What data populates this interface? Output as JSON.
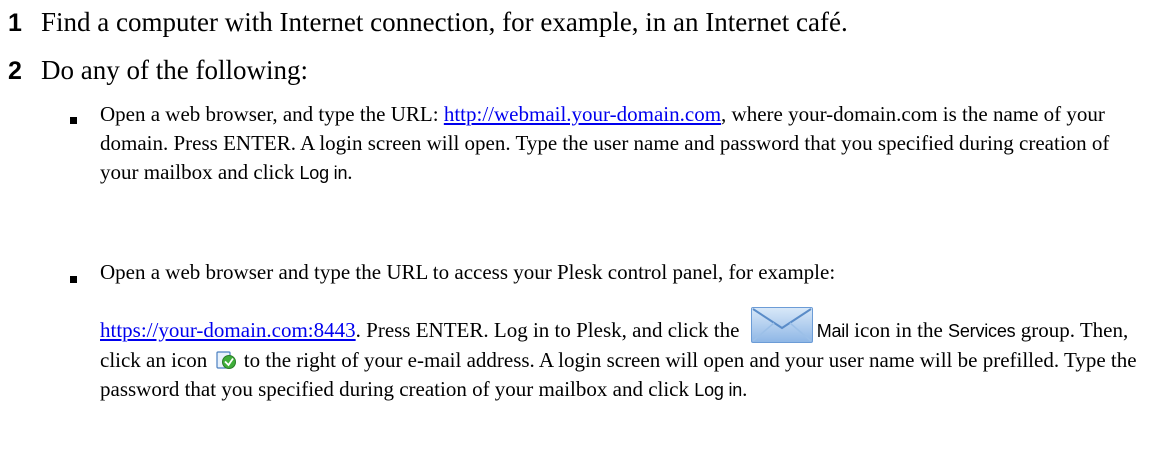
{
  "steps": [
    {
      "number": "1",
      "text": "Find a computer with Internet connection, for example, in an Internet café."
    },
    {
      "number": "2",
      "text": "Do any of the following:"
    }
  ],
  "bullet1": {
    "t1": "Open a web browser, and type the URL: ",
    "link": "http://webmail.your-domain.com",
    "t2": ", where your-domain.com is the name of your domain. Press ENTER. A login screen will open. Type the user name and password that you specified during creation of your mailbox and click ",
    "ui_log_in": "Log in",
    "t3": "."
  },
  "bullet2": {
    "t1": "Open a web browser and type the URL to access your Plesk control panel, for example:",
    "link": "https://your-domain.com:8443",
    "t2": ". Press ENTER. Log in to Plesk, and click the ",
    "mail_icon": "mail-icon",
    "ui_mail": "Mail",
    "t3": " icon in the ",
    "ui_services": "Services",
    "t4": " group. Then, click an icon ",
    "webmail_icon": "webmail-icon",
    "t5": " to the right of your e-mail address. A login screen will open and your user name will be prefilled. Type the password that you specified during creation of your mailbox and click ",
    "ui_log_in": "Log in",
    "t6": "."
  }
}
